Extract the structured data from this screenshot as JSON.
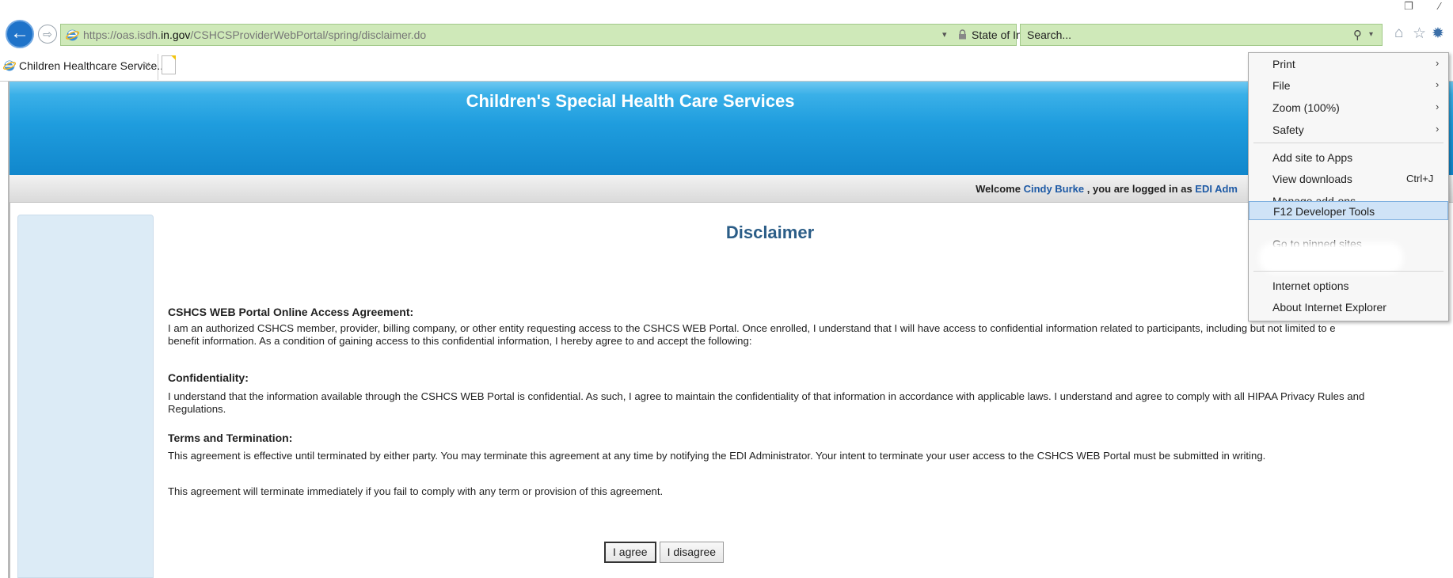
{
  "browser": {
    "address": {
      "url_prefix": "https://oas.isdh.",
      "url_domain": "in.gov",
      "url_path": "/CSHCSProviderWebPortal/spring/disclaimer.do",
      "site_identity": "State of Indiana [US]"
    },
    "search": {
      "placeholder": "Search..."
    },
    "tab": {
      "title": "Children Healthcare Service...",
      "close": "×"
    },
    "icons": [
      "back-arrow-icon",
      "forward-arrow-icon",
      "lock-icon",
      "refresh-icon",
      "search-icon",
      "home-icon",
      "star-icon",
      "gear-icon"
    ]
  },
  "page": {
    "banner_title": "Children's Special Health Care Services",
    "welcome": {
      "prefix": "Welcome ",
      "user": "Cindy Burke",
      "middle": " , you are logged in as ",
      "role": "EDI Adm"
    },
    "heading": "Disclaimer",
    "sections": [
      {
        "title": "CSHCS WEB Portal Online Access Agreement:",
        "text": "I am an authorized CSHCS member, provider, billing company, or other entity requesting access to the CSHCS WEB Portal. Once enrolled, I understand that I will have access to confidential information related to participants, including but not limited to e",
        "text2": "benefit information. As a condition of gaining access to this confidential information, I hereby agree to and accept the following:"
      },
      {
        "title": "Confidentiality:",
        "text": "I understand that the information available through the CSHCS WEB Portal is confidential. As such, I agree to maintain the confidentiality of that information in accordance with applicable laws. I understand and agree to comply with all HIPAA Privacy Rules and Regulations."
      },
      {
        "title": "Terms and Termination:",
        "text": "This agreement is effective until terminated by either party. You may terminate this agreement at any time by notifying the EDI Administrator. Your intent to terminate your user access to the CSHCS WEB Portal must be submitted in writing.",
        "text2": "This agreement will terminate immediately if you fail to comply with any term or provision of this agreement."
      }
    ],
    "buttons": {
      "agree": "I agree",
      "disagree": "I disagree"
    }
  },
  "menu": {
    "print": "Print",
    "file": "File",
    "zoom": "Zoom (100%)",
    "safety": "Safety",
    "add_site": "Add site to Apps",
    "view_downloads": "View downloads",
    "view_downloads_shortcut": "Ctrl+J",
    "manage_addons": "Manage add-ons",
    "devtools": "F12 Developer Tools",
    "pinned": "Go to pinned sites",
    "internet_options": "Internet options",
    "about": "About Internet Explorer",
    "submenu_arrow": "›"
  }
}
